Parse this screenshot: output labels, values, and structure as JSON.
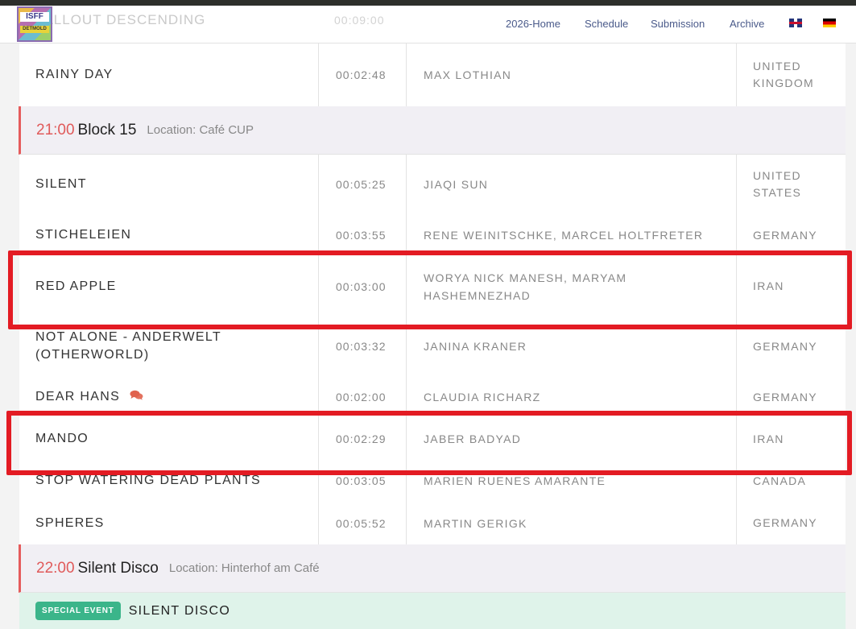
{
  "nav": {
    "ghost_title": "FALLOUT DESCENDING",
    "ghost_time": "00:09:00",
    "logo_text": "ISFF",
    "logo_sub": "DETMOLD",
    "links": [
      "2026-Home",
      "Schedule",
      "Submission",
      "Archive"
    ]
  },
  "rows_top": [
    {
      "title": "RAINY DAY",
      "time": "00:02:48",
      "director": "MAX LOTHIAN",
      "country": "UNITED KINGDOM"
    }
  ],
  "block15": {
    "time": "21:00",
    "name": "Block 15",
    "location": "Location: Café CUP"
  },
  "rows": [
    {
      "title": "SILENT",
      "time": "00:05:25",
      "director": "JIAQI SUN",
      "country": "UNITED STATES"
    },
    {
      "title": "STICHELEIEN",
      "time": "00:03:55",
      "director": "RENE WEINITSCHKE, MARCEL HOLTFRETER",
      "country": "GERMANY"
    },
    {
      "title": "RED APPLE",
      "time": "00:03:00",
      "director": "WORYA NICK MANESH, MARYAM HASHEMNEZHAD",
      "country": "IRAN"
    },
    {
      "title": "NOT ALONE - ANDERWELT (OTHERWORLD)",
      "time": "00:03:32",
      "director": "JANINA KRANER",
      "country": "GERMANY"
    },
    {
      "title": "DEAR HANS",
      "time": "00:02:00",
      "director": "CLAUDIA RICHARZ",
      "country": "GERMANY"
    },
    {
      "title": "MANDO",
      "time": "00:02:29",
      "director": "JABER BADYAD",
      "country": "IRAN"
    },
    {
      "title": "STOP WATERING DEAD PLANTS",
      "time": "00:03:05",
      "director": "MARIEN RUENES AMARANTE",
      "country": "CANADA"
    },
    {
      "title": "SPHERES",
      "time": "00:05:52",
      "director": "MARTIN GERIGK",
      "country": "GERMANY"
    }
  ],
  "block22": {
    "time": "22:00",
    "name": "Silent Disco",
    "location": "Location: Hinterhof am Café"
  },
  "special": {
    "badge": "SPECIAL EVENT",
    "title": "SILENT DISCO"
  },
  "colors": {
    "accent_red": "#e05a5a",
    "highlight": "#e31b23",
    "badge_green": "#3bb58a"
  }
}
